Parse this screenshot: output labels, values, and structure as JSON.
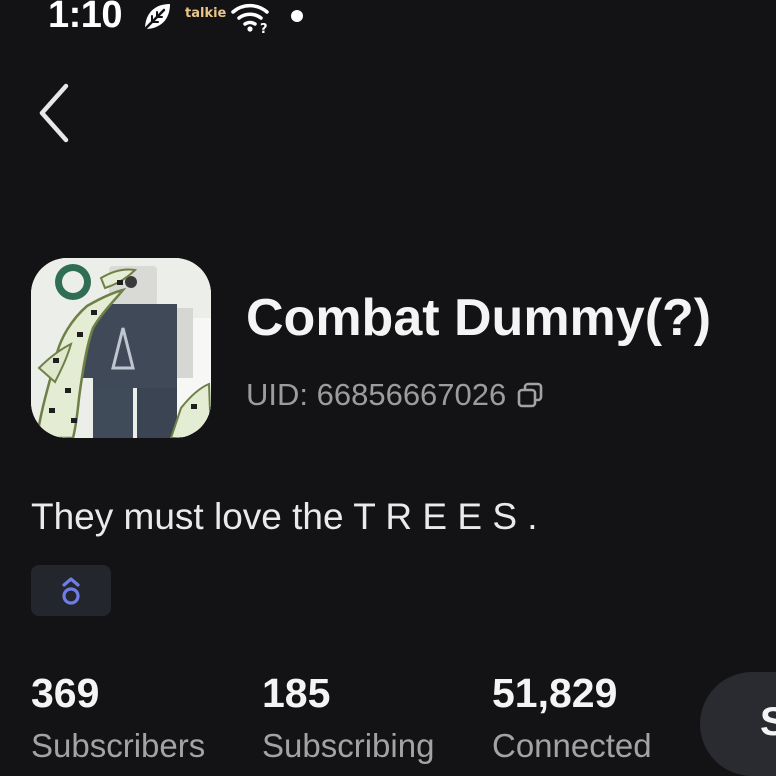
{
  "status_bar": {
    "time": "1:10",
    "app_badge": "talkie",
    "icons": [
      "leaf-icon",
      "wifi-icon",
      "notification-dot"
    ]
  },
  "navigation": {
    "back_icon": "chevron-left-icon"
  },
  "profile": {
    "name": "Combat Dummy(?)",
    "uid": "UID: 66856667026",
    "copy_icon": "copy-icon",
    "bio": "They must love the T R E E S .",
    "badge_icon": "gender-symbol-icon"
  },
  "stats": [
    {
      "value": "369",
      "label": "Subscribers"
    },
    {
      "value": "185",
      "label": "Subscribing"
    },
    {
      "value": "51,829",
      "label": "Connected"
    }
  ],
  "subscribe_button": {
    "label": "S"
  },
  "colors": {
    "background": "#131315",
    "text_primary": "#f4f4f4",
    "text_secondary": "#a3a3a6",
    "badge_bg": "#24262d",
    "badge_icon": "#6f7de6",
    "button_bg": "#2a2b30",
    "talkie_accent": "#e9c58a"
  }
}
